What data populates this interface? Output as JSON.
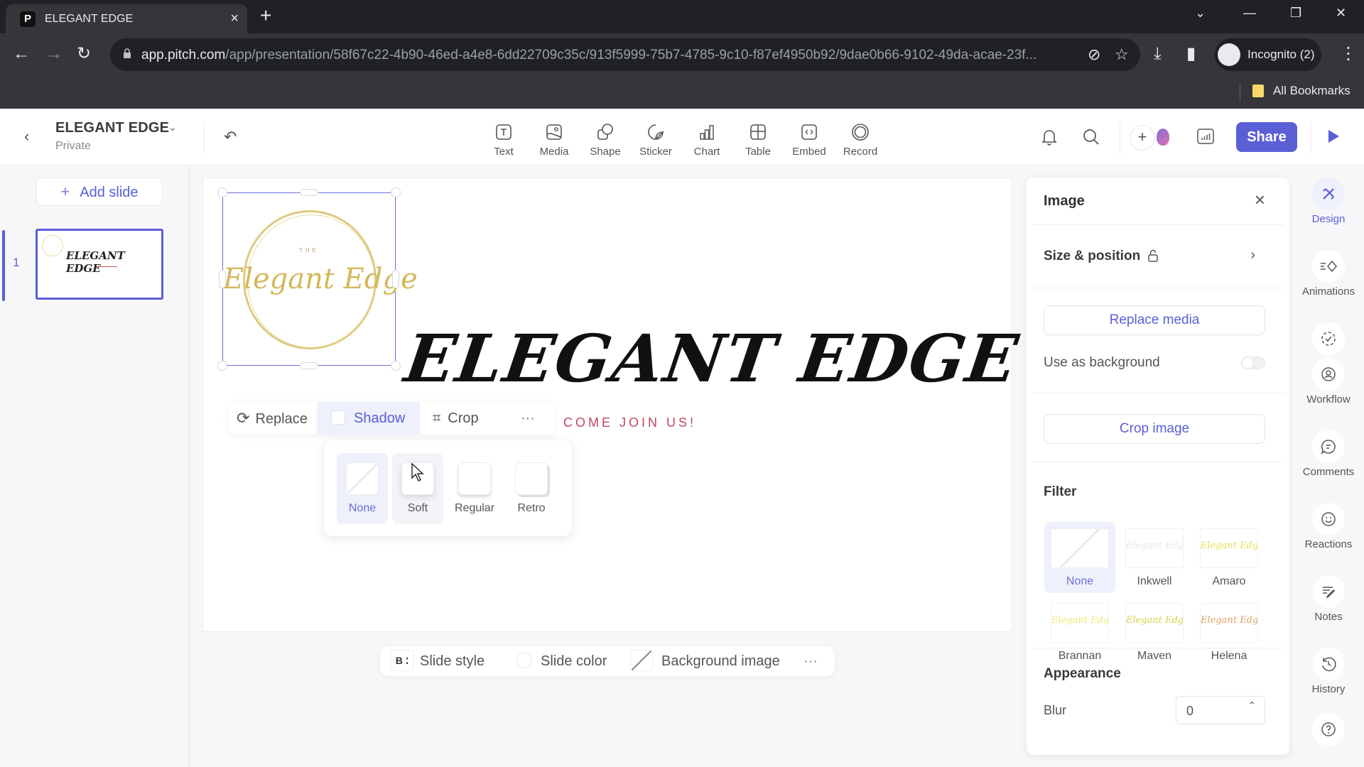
{
  "browser": {
    "tab_title": "ELEGANT EDGE",
    "favicon_letter": "P",
    "url_host": "app.pitch.com",
    "url_path": "/app/presentation/58f67c22-4b90-46ed-a4e8-6dd22709c35c/913f5999-75b7-4785-9c10-f87ef4950b92/9dae0b66-9102-49da-acae-23f...",
    "profile_label": "Incognito (2)",
    "bookmarks_label": "All Bookmarks"
  },
  "header": {
    "doc_title": "ELEGANT EDGE",
    "doc_visibility": "Private",
    "tools": [
      {
        "label": "Text",
        "icon": "text-icon"
      },
      {
        "label": "Media",
        "icon": "media-icon"
      },
      {
        "label": "Shape",
        "icon": "shape-icon"
      },
      {
        "label": "Sticker",
        "icon": "sticker-icon"
      },
      {
        "label": "Chart",
        "icon": "chart-icon"
      },
      {
        "label": "Table",
        "icon": "table-icon"
      },
      {
        "label": "Embed",
        "icon": "embed-icon"
      },
      {
        "label": "Record",
        "icon": "record-icon"
      }
    ],
    "share_label": "Share"
  },
  "sidebar": {
    "add_slide_label": "Add slide",
    "slides": [
      {
        "number": "1",
        "title": "ELEGANT EDGE"
      }
    ]
  },
  "slide": {
    "logo_small": "THE",
    "logo_text": "Elegant Edge",
    "title": "ELEGANT EDGE",
    "subtitle": "COME JOIN US!"
  },
  "image_toolbar": {
    "replace_label": "Replace",
    "shadow_label": "Shadow",
    "crop_label": "Crop",
    "more_label": "···"
  },
  "shadow_popover": {
    "options": [
      {
        "label": "None",
        "selected": true
      },
      {
        "label": "Soft",
        "selected": false
      },
      {
        "label": "Regular",
        "selected": false
      },
      {
        "label": "Retro",
        "selected": false
      }
    ]
  },
  "bottom_bar": {
    "style_badge": "B",
    "slide_style_label": "Slide style",
    "slide_color_label": "Slide color",
    "background_image_label": "Background image",
    "more_label": "···"
  },
  "panel": {
    "title": "Image",
    "size_position_label": "Size & position",
    "replace_media_label": "Replace media",
    "use_as_background_label": "Use as background",
    "use_as_background_on": false,
    "crop_image_label": "Crop image",
    "filter_label": "Filter",
    "filters": [
      {
        "label": "None",
        "selected": true
      },
      {
        "label": "Inkwell",
        "selected": false
      },
      {
        "label": "Amaro",
        "selected": false
      },
      {
        "label": "Brannan",
        "selected": false
      },
      {
        "label": "Maven",
        "selected": false
      },
      {
        "label": "Helena",
        "selected": false
      }
    ],
    "appearance_label": "Appearance",
    "blur_label": "Blur",
    "blur_value": "0"
  },
  "rail": {
    "items": [
      {
        "label": "Design",
        "active": true
      },
      {
        "label": "Animations"
      },
      {
        "label": "Workflow"
      },
      {
        "label": "Comments"
      },
      {
        "label": "Reactions"
      },
      {
        "label": "Notes"
      },
      {
        "label": "History"
      }
    ]
  },
  "colors": {
    "accent": "#5a5fd6",
    "subtitle": "#c0485f",
    "logo_gold": "#d4b85a"
  }
}
